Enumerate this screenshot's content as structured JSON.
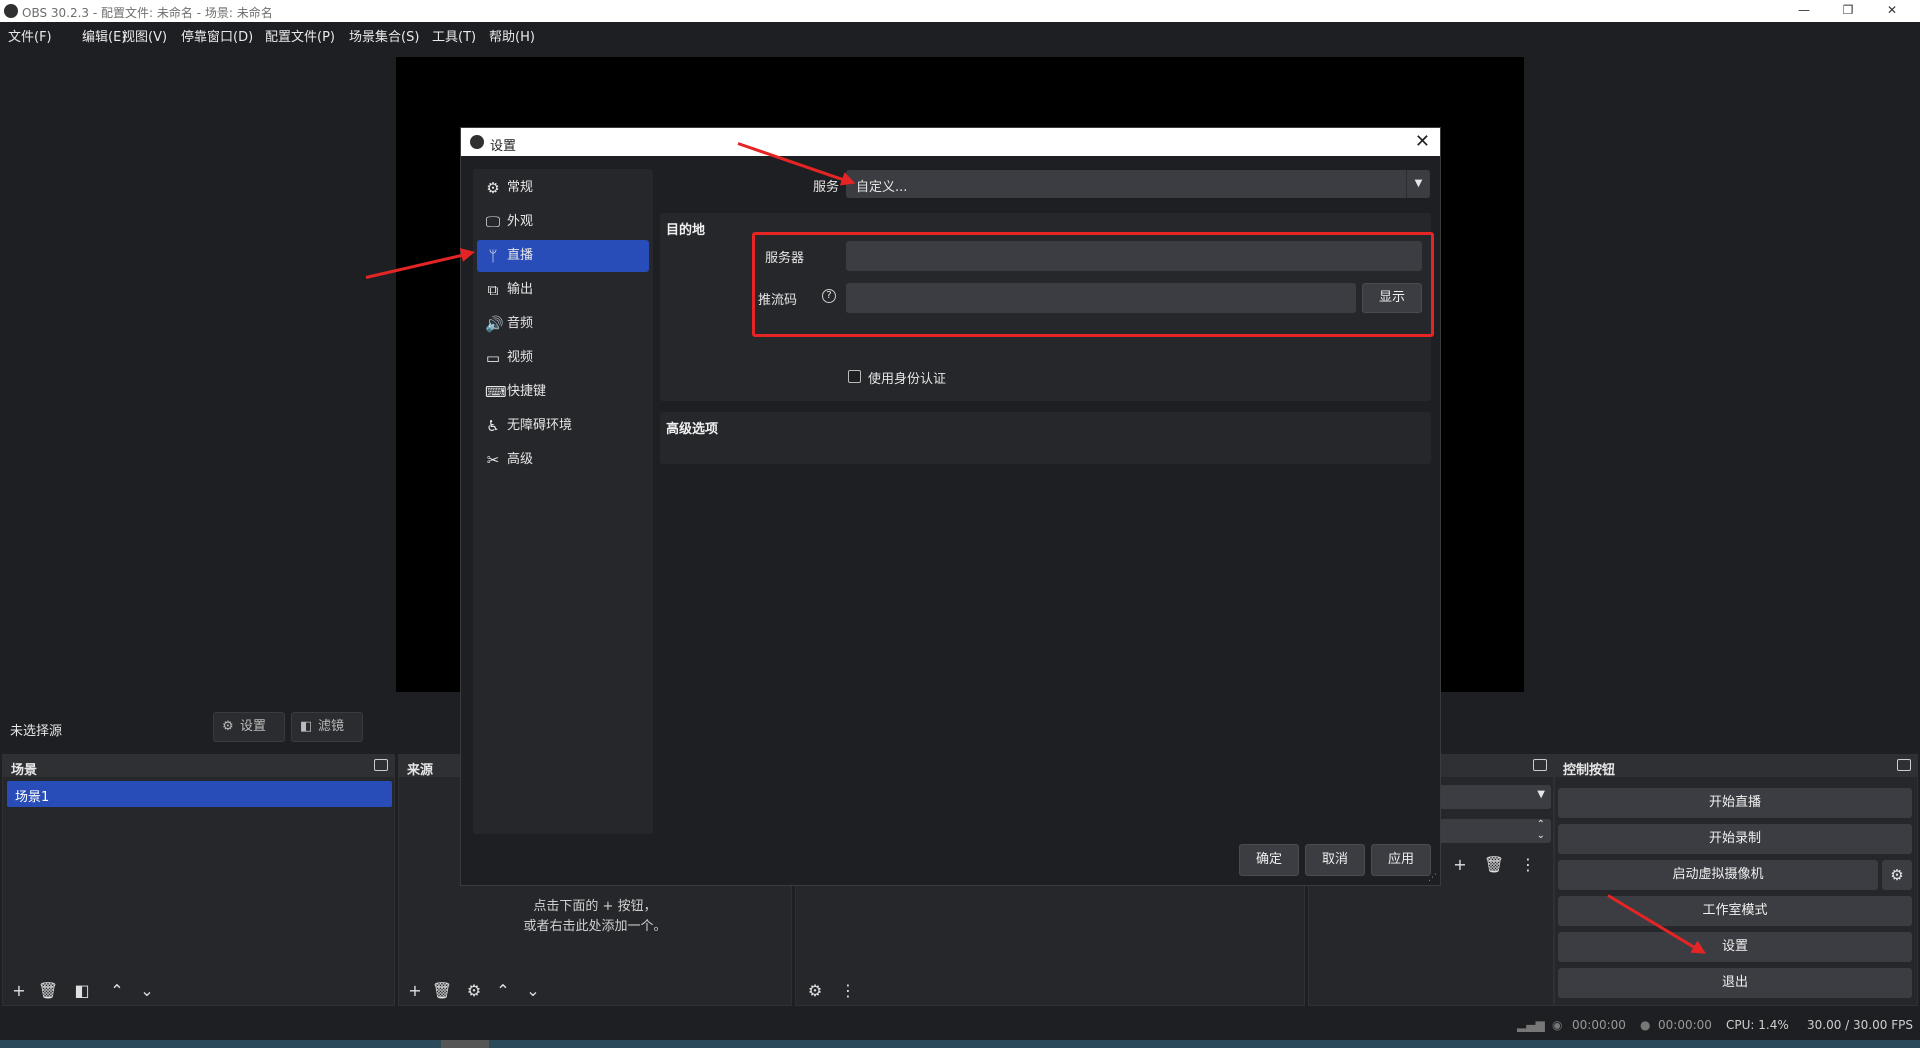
{
  "window": {
    "title": "OBS 30.2.3 - 配置文件: 未命名 - 场景: 未命名"
  },
  "menu": [
    "文件(F)",
    "编辑(E)",
    "视图(V)",
    "停靠窗口(D)",
    "配置文件(P)",
    "场景集合(S)",
    "工具(T)",
    "帮助(H)"
  ],
  "sourcebar": {
    "no_source": "未选择源",
    "settings": "设置",
    "filters": "滤镜"
  },
  "docks": {
    "scenes": {
      "title": "场景",
      "items": [
        "场景1"
      ]
    },
    "sources": {
      "title": "来源",
      "empty_line2": "点击下面的 + 按钮，",
      "empty_line3": "或者右击此处添加一个。"
    },
    "controls": {
      "title": "控制按钮",
      "buttons": [
        "开始直播",
        "开始录制",
        "启动虚拟摄像机",
        "工作室模式",
        "设置",
        "退出"
      ]
    }
  },
  "status": {
    "t1": "00:00:00",
    "t2": "00:00:00",
    "cpu": "CPU: 1.4%",
    "fps": "30.00 / 30.00 FPS"
  },
  "dialog": {
    "title": "设置",
    "nav": [
      "常规",
      "外观",
      "直播",
      "输出",
      "音频",
      "视频",
      "快捷键",
      "无障碍环境",
      "高级"
    ],
    "nav_icons": [
      "gear-icon",
      "appearance-icon",
      "antenna-icon",
      "output-icon",
      "speaker-icon",
      "monitor-icon",
      "keyboard-icon",
      "accessibility-icon",
      "tools-icon"
    ],
    "active_nav": "直播",
    "service_label": "服务",
    "service_value": "自定义...",
    "destination_title": "目的地",
    "server_label": "服务器",
    "stream_key_label": "推流码",
    "show_button": "显示",
    "auth_checkbox": "使用身份认证",
    "advanced_title": "高级选项",
    "ok": "确定",
    "cancel": "取消",
    "apply": "应用"
  },
  "colors": {
    "accent": "#284cb8",
    "annotation": "#e52525"
  }
}
